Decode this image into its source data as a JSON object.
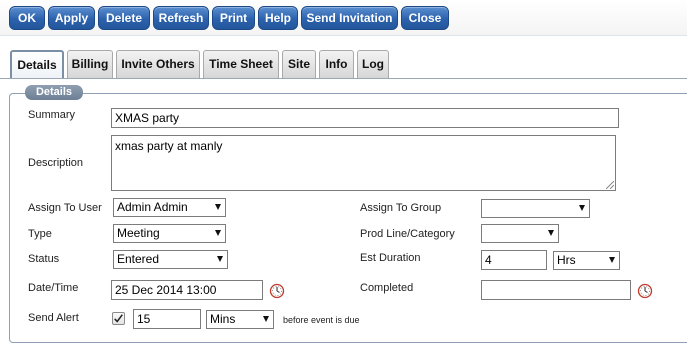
{
  "toolbar": {
    "buttons": [
      "OK",
      "Apply",
      "Delete",
      "Refresh",
      "Print",
      "Help",
      "Send Invitation",
      "Close"
    ]
  },
  "tabs": [
    "Details",
    "Billing",
    "Invite Others",
    "Time Sheet",
    "Site",
    "Info",
    "Log"
  ],
  "active_tab": "Details",
  "section": {
    "legend": "Details"
  },
  "form": {
    "summary_label": "Summary",
    "summary_value": "XMAS party",
    "description_label": "Description",
    "description_value": "xmas party at manly",
    "assign_user_label": "Assign To User",
    "assign_user_value": "Admin Admin",
    "assign_group_label": "Assign To Group",
    "assign_group_value": "",
    "type_label": "Type",
    "type_value": "Meeting",
    "prodline_label": "Prod Line/Category",
    "prodline_value": "",
    "status_label": "Status",
    "status_value": "Entered",
    "est_duration_label": "Est Duration",
    "est_duration_value": "4",
    "est_duration_unit": "Hrs",
    "datetime_label": "Date/Time",
    "datetime_value": "25 Dec 2014 13:00",
    "completed_label": "Completed",
    "completed_value": "",
    "alert_label": "Send Alert",
    "alert_checked": true,
    "alert_value": "15",
    "alert_unit": "Mins",
    "alert_suffix": "before event is due"
  },
  "icons": {
    "clock": "clock-icon",
    "check": "check-icon",
    "dropdown": "chevron-down-icon"
  }
}
